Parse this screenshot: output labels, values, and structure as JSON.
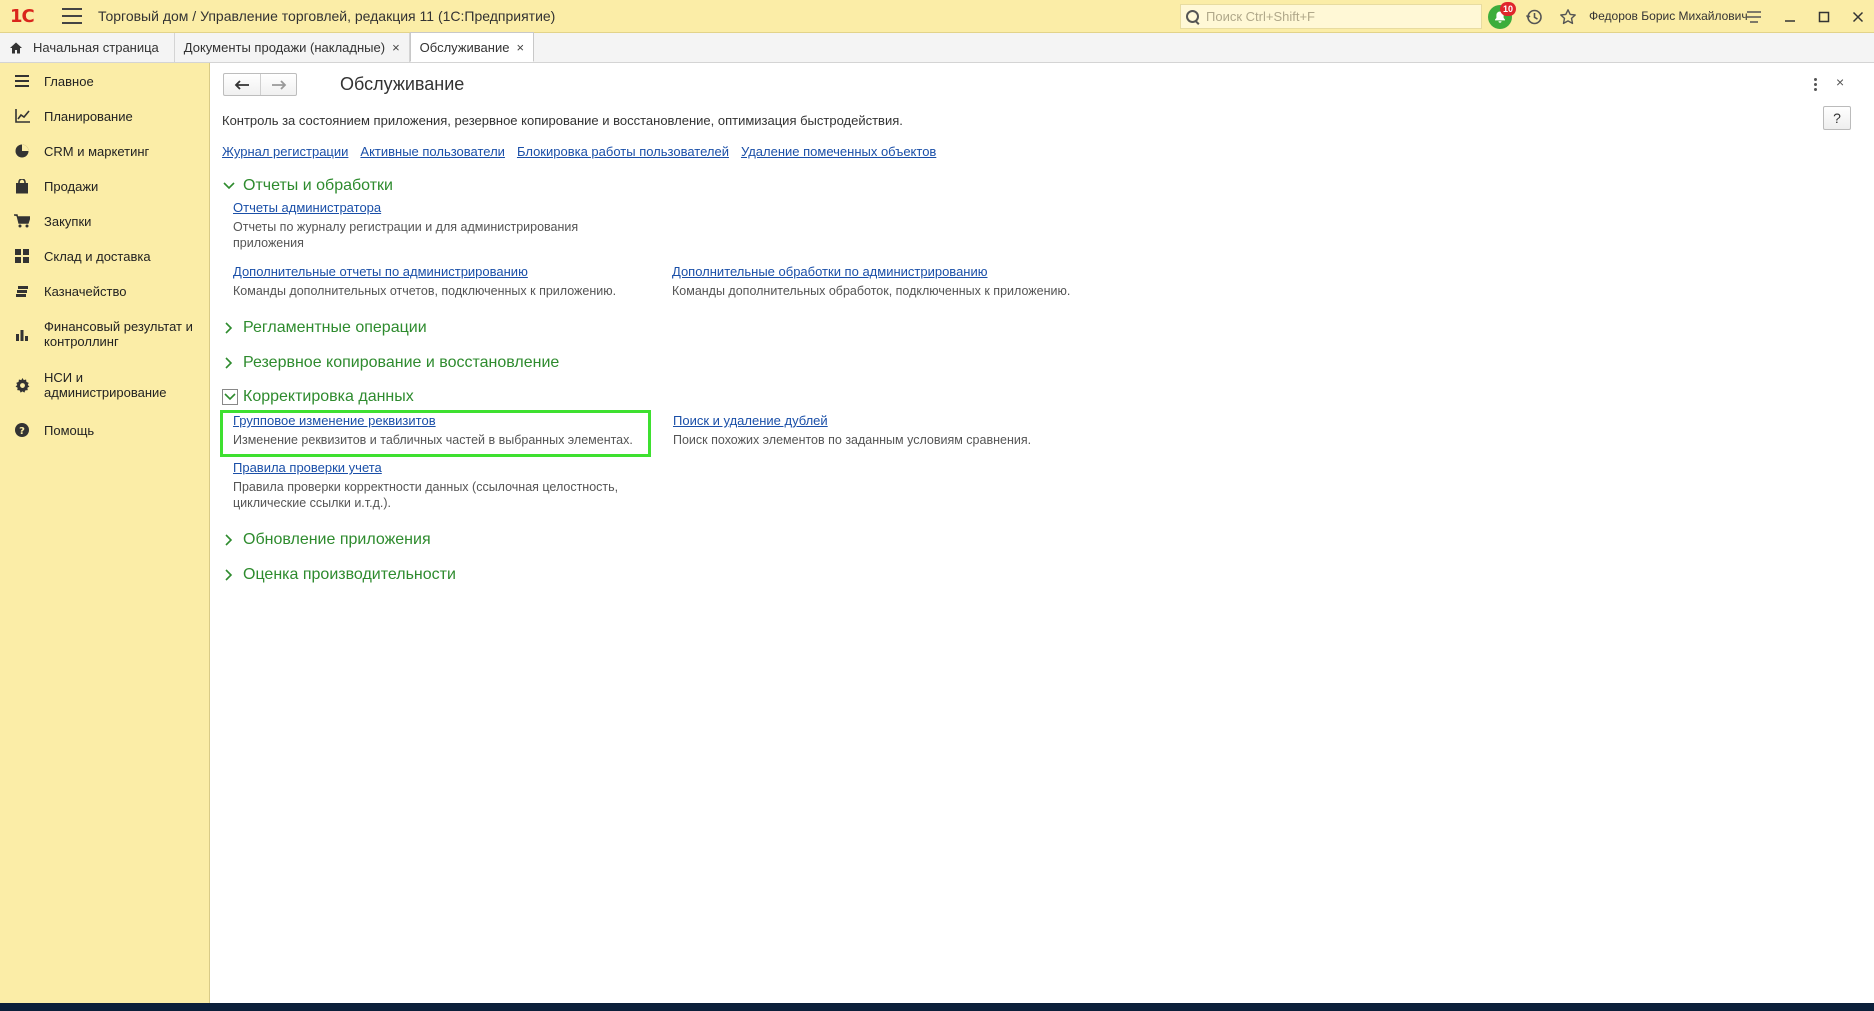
{
  "titlebar": {
    "logo_text": "1С",
    "app_title": "Торговый дом / Управление торговлей, редакция 11  (1С:Предприятие)",
    "search_placeholder": "Поиск Ctrl+Shift+F",
    "notifications_count": "10",
    "user_name": "Федоров Борис Михайлович",
    "accent_color": "#fbeda7"
  },
  "tabs": [
    {
      "label": "Начальная страница",
      "icon": "home-icon"
    },
    {
      "label": "Документы продажи (накладные)",
      "close": "×"
    },
    {
      "label": "Обслуживание",
      "close": "×",
      "active": true
    }
  ],
  "sidebar": {
    "items": [
      {
        "label": "Главное",
        "icon": "menu-lines-icon"
      },
      {
        "label": "Планирование",
        "icon": "chart-trend-icon"
      },
      {
        "label": "CRM и маркетинг",
        "icon": "pie-chart-icon"
      },
      {
        "label": "Продажи",
        "icon": "shopping-bag-icon"
      },
      {
        "label": "Закупки",
        "icon": "cart-icon"
      },
      {
        "label": "Склад и доставка",
        "icon": "warehouse-grid-icon"
      },
      {
        "label": "Казначейство",
        "icon": "coins-icon"
      },
      {
        "label": "Финансовый результат и контроллинг",
        "icon": "bar-chart-icon"
      },
      {
        "label": "НСИ и администрирование",
        "icon": "gear-icon"
      },
      {
        "label": "Помощь",
        "icon": "question-icon"
      }
    ]
  },
  "main": {
    "title": "Обслуживание",
    "help_label": "?",
    "close_label": "×",
    "description": "Контроль за состоянием приложения, резервное копирование и восстановление, оптимизация быстродействия.",
    "top_links": [
      "Журнал регистрации",
      "Активные пользователи",
      "Блокировка работы пользователей",
      "Удаление помеченных объектов"
    ],
    "sections": {
      "reports": {
        "title": "Отчеты и обработки",
        "expanded": true,
        "items": [
          {
            "link": "Отчеты администратора",
            "desc": "Отчеты по журналу регистрации и для администрирования приложения"
          },
          {
            "link": "Дополнительные отчеты по администрированию",
            "desc": "Команды дополнительных отчетов, подключенных к приложению."
          },
          {
            "link": "Дополнительные обработки по администрированию",
            "desc": "Команды дополнительных обработок, подключенных к приложению."
          }
        ]
      },
      "routine": {
        "title": "Регламентные операции",
        "expanded": false
      },
      "backup": {
        "title": "Резервное копирование и восстановление",
        "expanded": false
      },
      "correction": {
        "title": "Корректировка данных",
        "expanded": true,
        "items": [
          {
            "link": "Групповое изменение реквизитов",
            "desc": "Изменение реквизитов и табличных частей в выбранных элементах."
          },
          {
            "link": "Поиск и удаление дублей",
            "desc": "Поиск похожих элементов по заданным условиям сравнения."
          },
          {
            "link": "Правила проверки учета",
            "desc": "Правила проверки корректности данных (ссылочная целостность, циклические ссылки и.т.д.)."
          }
        ]
      },
      "update": {
        "title": "Обновление приложения",
        "expanded": false
      },
      "performance": {
        "title": "Оценка производительности",
        "expanded": false
      }
    },
    "highlight_color": "#3ee030",
    "section_color": "#2e8b2e",
    "link_color": "#1a4fa8"
  }
}
